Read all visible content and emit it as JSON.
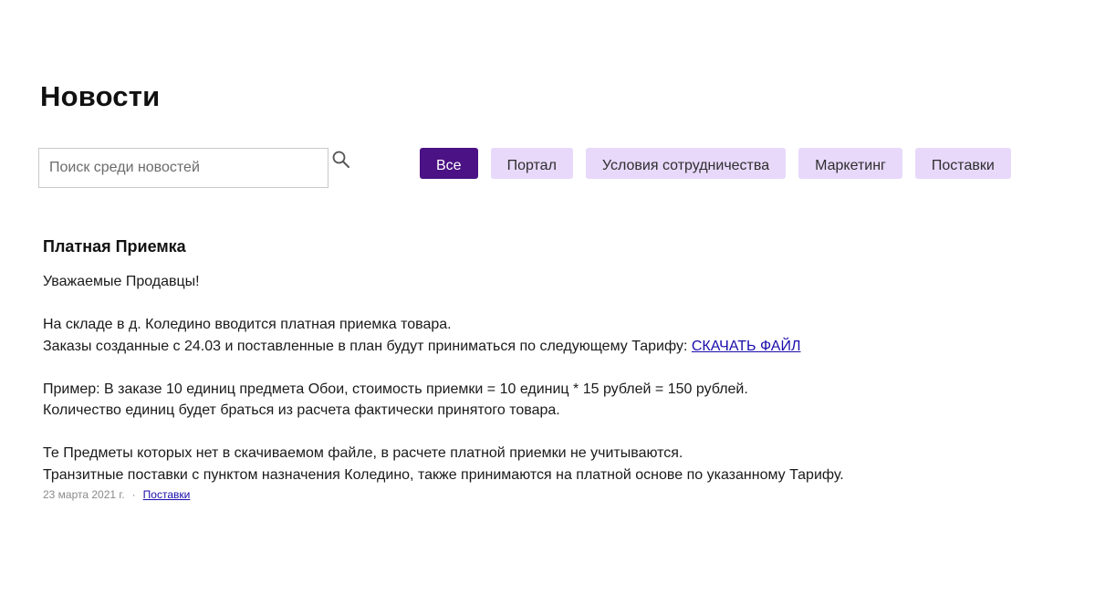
{
  "page": {
    "title": "Новости"
  },
  "search": {
    "placeholder": "Поиск среди новостей",
    "value": "",
    "icon": "search-icon"
  },
  "filters": [
    {
      "label": "Все",
      "active": true
    },
    {
      "label": "Портал",
      "active": false
    },
    {
      "label": "Условия сотрудничества",
      "active": false
    },
    {
      "label": "Маркетинг",
      "active": false
    },
    {
      "label": "Поставки",
      "active": false
    }
  ],
  "colors": {
    "active_filter_bg": "#4b1285",
    "filter_bg": "#e8d9fb",
    "link": "#1a0dab"
  },
  "article": {
    "title": "Платная Приемка",
    "greeting": "Уважаемые Продавцы!",
    "p1_line1": "На складе в д. Коледино вводится платная приемка товара.",
    "p1_line2": "Заказы созданные с 24.03 и поставленные в план будут приниматься по следующему Тарифу:",
    "link_text": "СКАЧАТЬ ФАЙЛ",
    "p2_line1": "Пример: В заказе 10 единиц предмета Обои, стоимость приемки = 10 единиц * 15 рублей = 150 рублей.",
    "p2_line2": "Количество единиц будет браться из расчета фактически принятого товара.",
    "p3_line1": "Те Предметы которых нет в скачиваемом файле, в расчете платной приемки не учитываются.",
    "p3_line2": "Транзитные поставки с пунктом назначения Коледино, также принимаются на платной основе по указанному Тарифу.",
    "date": "23 марта 2021 г.",
    "separator": "·",
    "category": "Поставки"
  }
}
